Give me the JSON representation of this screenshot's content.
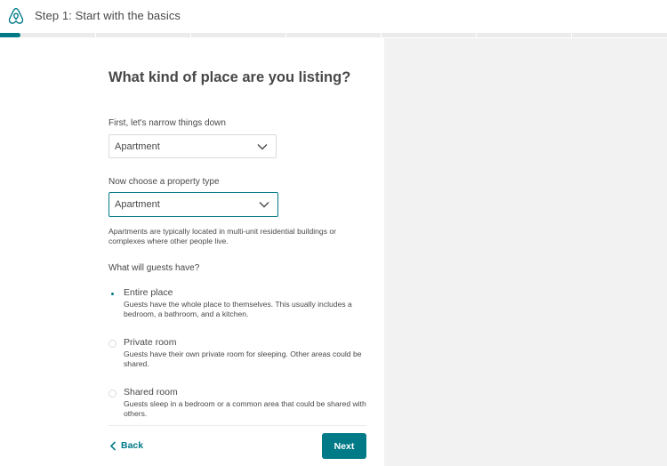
{
  "header": {
    "logo_icon": "airbnb-logo-icon",
    "step_title": "Step 1: Start with the basics",
    "progress_fraction": 0.03
  },
  "main": {
    "heading": "What kind of place are you listing?",
    "category": {
      "label": "First, let's narrow things down",
      "value": "Apartment"
    },
    "property_type": {
      "label": "Now choose a property type",
      "value": "Apartment",
      "help": "Apartments are typically located in multi-unit residential buildings or complexes where other people live."
    },
    "guests_have": {
      "label": "What will guests have?",
      "options": [
        {
          "title": "Entire place",
          "description": "Guests have the whole place to themselves. This usually includes a bedroom, a bathroom, and a kitchen.",
          "selected": true
        },
        {
          "title": "Private room",
          "description": "Guests have their own private room for sleeping. Other areas could be shared.",
          "selected": false
        },
        {
          "title": "Shared room",
          "description": "Guests sleep in a bedroom or a common area that could be shared with others.",
          "selected": false
        }
      ]
    }
  },
  "footer": {
    "back_label": "Back",
    "next_label": "Next"
  },
  "colors": {
    "accent": "#007a87",
    "text": "#484848",
    "border": "#dbdbdb",
    "side_panel": "#f2f2f2"
  }
}
